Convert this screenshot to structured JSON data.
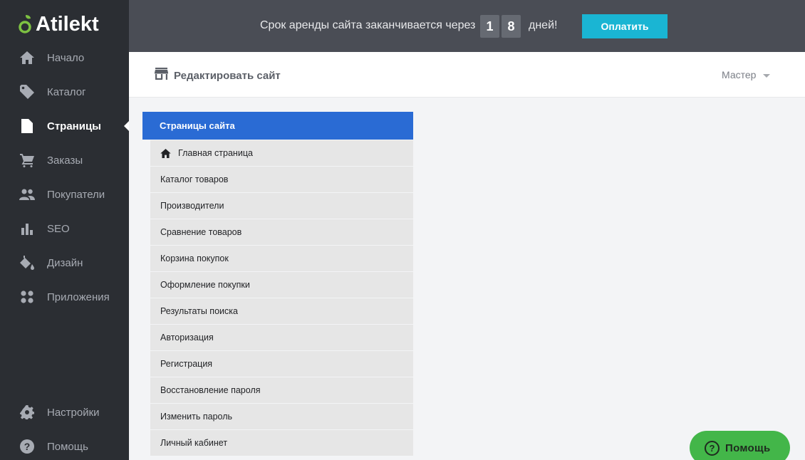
{
  "brand": {
    "name": "Atilekt",
    "leaf_color": "#7dc142"
  },
  "sidebar": {
    "items": [
      {
        "label": "Начало",
        "icon": "home-icon"
      },
      {
        "label": "Каталог",
        "icon": "tag-icon"
      },
      {
        "label": "Страницы",
        "icon": "document-icon",
        "active": true
      },
      {
        "label": "Заказы",
        "icon": "cart-icon"
      },
      {
        "label": "Покупатели",
        "icon": "people-icon"
      },
      {
        "label": "SEO",
        "icon": "bar-chart-icon"
      },
      {
        "label": "Дизайн",
        "icon": "paint-bucket-icon"
      },
      {
        "label": "Приложения",
        "icon": "apps-grid-icon"
      }
    ],
    "bottom_items": [
      {
        "label": "Настройки",
        "icon": "gear-icon"
      },
      {
        "label": "Помощь",
        "icon": "help-circle-icon"
      }
    ]
  },
  "banner": {
    "text": "Срок аренды сайта заканчивается через",
    "digits": [
      "1",
      "8"
    ],
    "suffix": "дней!",
    "pay_label": "Оплатить",
    "pay_color": "#1ab5d3"
  },
  "header": {
    "edit_site_label": "Редактировать сайт",
    "master_label": "Мастер"
  },
  "pages_panel": {
    "title": "Страницы сайта",
    "title_color": "#2a6bd4",
    "items": [
      "Главная страница",
      "Каталог товаров",
      "Производители",
      "Сравнение товаров",
      "Корзина покупок",
      "Оформление покупки",
      "Результаты поиска",
      "Авторизация",
      "Регистрация",
      "Восстановление пароля",
      "Изменить пароль",
      "Личный кабинет"
    ]
  },
  "help_button": {
    "label": "Помощь",
    "color": "#43b649"
  }
}
